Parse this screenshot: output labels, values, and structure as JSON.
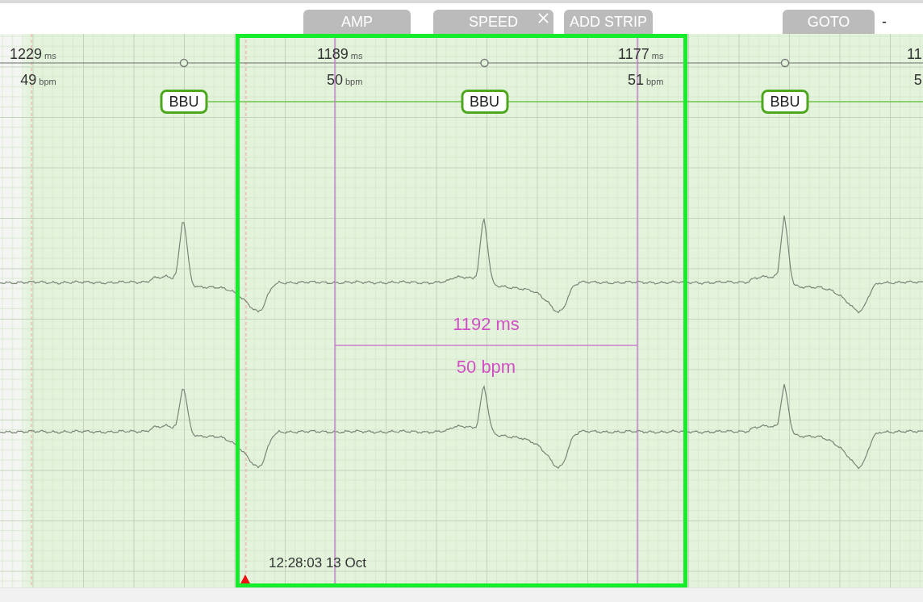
{
  "toolbar": {
    "buttons": [
      {
        "label": "AMP",
        "closable": false
      },
      {
        "label": "SPEED",
        "closable": true
      },
      {
        "label": "ADD STRIP",
        "closable": false
      }
    ],
    "goto": {
      "label": "GOTO",
      "value": "-"
    }
  },
  "strip": {
    "intervals": [
      {
        "ms": "1229",
        "ms_unit": "ms",
        "bpm": "49",
        "bpm_unit": "bpm"
      },
      {
        "ms": "1189",
        "ms_unit": "ms",
        "bpm": "50",
        "bpm_unit": "bpm"
      },
      {
        "ms": "1177",
        "ms_unit": "ms",
        "bpm": "51",
        "bpm_unit": "bpm"
      },
      {
        "ms": "11",
        "bpm": "5"
      }
    ],
    "beat_labels": [
      "BBU",
      "BBU",
      "BBU"
    ],
    "caliper": {
      "interval": "1192 ms",
      "rate": "50 bpm"
    },
    "timestamp": "12:28:03 13 Oct"
  }
}
